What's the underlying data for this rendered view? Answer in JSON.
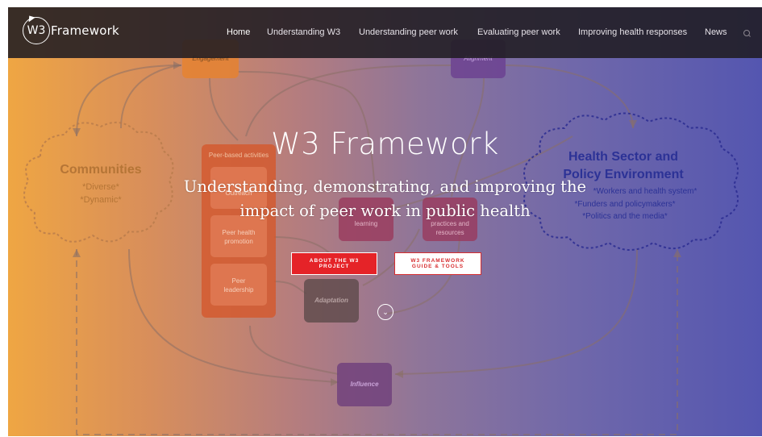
{
  "logo": {
    "mark": "W3",
    "name": "Framework"
  },
  "nav": {
    "items": [
      {
        "label": "Home",
        "active": true
      },
      {
        "label": "Understanding W3",
        "active": false
      },
      {
        "label": "Understanding peer work",
        "active": false
      },
      {
        "label": "Evaluating peer work",
        "active": false
      },
      {
        "label": "Improving health responses",
        "active": false
      },
      {
        "label": "News",
        "active": false
      }
    ],
    "search_icon": "search-icon"
  },
  "hero": {
    "title": "W3 Framework",
    "subtitle": "Understanding, demonstrating, and improving the impact of peer work in public health",
    "buttons": {
      "about": "ABOUT THE W3 PROJECT",
      "guide": "W3 FRAMEWORK GUIDE & TOOLS"
    },
    "scroll_icon": "chevron-down-icon"
  },
  "diagram": {
    "engagement": "Engagement",
    "alignment": "Alignment",
    "communities_title": "Communities",
    "communities_lines": [
      "*Diverse*",
      "*Dynamic*"
    ],
    "health_title_1": "Health Sector and",
    "health_title_2": "Policy Environment",
    "health_lines": [
      "*Workers and health system*",
      "*Funders and policymakers*",
      "*Politics and the media*"
    ],
    "peer_activities": "Peer-based activities",
    "peer_box_1": "Outreach",
    "peer_box_2_a": "Peer health",
    "peer_box_2_b": "promotion",
    "peer_box_3_a": "Peer",
    "peer_box_3_b": "leadership",
    "learning": "learning",
    "practices_a": "practices and",
    "practices_b": "resources",
    "adaptation": "Adaptation",
    "influence": "Influence"
  },
  "colors": {
    "gradient_left": "#efa643",
    "gradient_right": "#5456b0",
    "navbar": "#201c22",
    "button_red": "#e52328"
  }
}
